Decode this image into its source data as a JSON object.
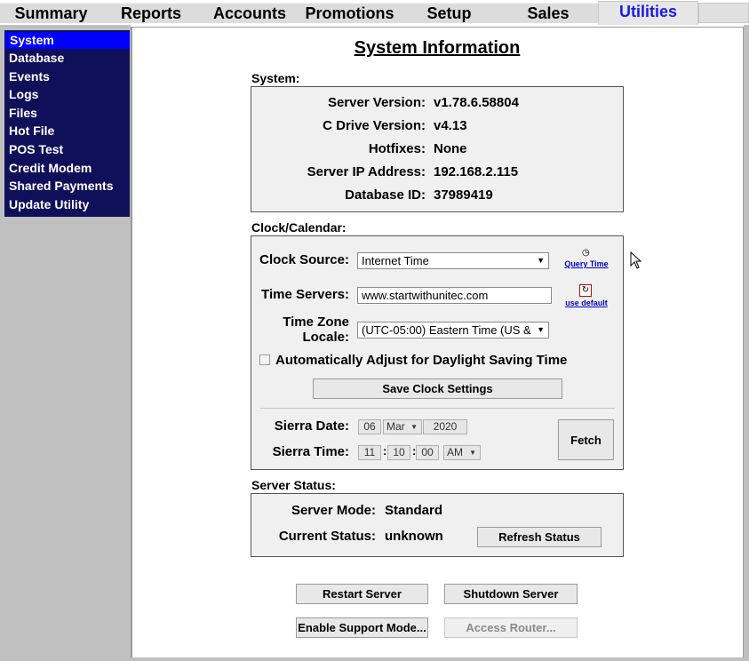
{
  "tabs": [
    "Summary",
    "Reports",
    "Accounts",
    "Promotions",
    "Setup",
    "Sales",
    "Utilities"
  ],
  "active_tab": "Utilities",
  "sidebar": {
    "items": [
      "System",
      "Database",
      "Events",
      "Logs",
      "Files",
      "Hot File",
      "POS Test",
      "Credit Modem",
      "Shared Payments",
      "Update Utility"
    ],
    "active": "System"
  },
  "page_title": "System Information",
  "system": {
    "heading": "System:",
    "rows": [
      {
        "label": "Server Version:",
        "value": "v1.78.6.58804"
      },
      {
        "label": "C Drive Version:",
        "value": "v4.13"
      },
      {
        "label": "Hotfixes:",
        "value": "None"
      },
      {
        "label": "Server IP Address:",
        "value": "192.168.2.115"
      },
      {
        "label": "Database ID:",
        "value": "37989419"
      }
    ]
  },
  "clock": {
    "heading": "Clock/Calendar:",
    "source_label": "Clock Source:",
    "source_value": "Internet Time",
    "query_time_link": "Query Time",
    "servers_label": "Time Servers:",
    "servers_value": "www.startwithunitec.com",
    "use_default_link": "use default",
    "tz_label_1": "Time Zone",
    "tz_label_2": "Locale:",
    "tz_value": "(UTC-05:00) Eastern Time (US &",
    "dst_label": "Automatically Adjust for Daylight Saving Time",
    "dst_checked": false,
    "save_button": "Save Clock Settings",
    "date_label": "Sierra Date:",
    "date_day": "06",
    "date_month": "Mar",
    "date_year": "2020",
    "time_label": "Sierra Time:",
    "time_hour": "11",
    "time_min": "10",
    "time_sec": "00",
    "time_ampm": "AM",
    "fetch_button": "Fetch"
  },
  "status": {
    "heading": "Server Status:",
    "mode_label": "Server Mode:",
    "mode_value": "Standard",
    "current_label": "Current Status:",
    "current_value": "unknown",
    "refresh_button": "Refresh Status"
  },
  "actions": {
    "restart": "Restart Server",
    "shutdown": "Shutdown Server",
    "support": "Enable Support Mode...",
    "router": "Access Router..."
  }
}
